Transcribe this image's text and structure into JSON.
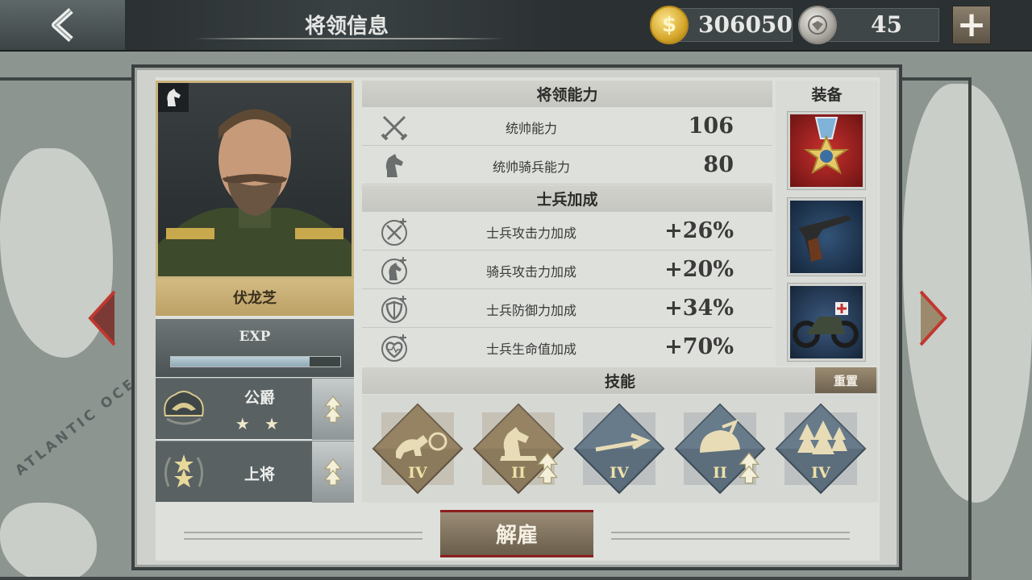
{
  "header": {
    "title": "将领信息",
    "gold": "306050",
    "medals": "45",
    "gold_icon": "$"
  },
  "map": {
    "ocean_label": "ATLANTIC OCE"
  },
  "general": {
    "name": "伏龙芝",
    "exp_label": "EXP",
    "exp_progress": 0.82,
    "nobility": "公爵",
    "nobility_stars": "★ ★",
    "military_rank": "上将"
  },
  "command": {
    "header": "将领能力",
    "stats": [
      {
        "icon": "crossed-swords-icon",
        "label": "统帅能力",
        "value": "106"
      },
      {
        "icon": "knight-horse-icon",
        "label": "统帅骑兵能力",
        "value": "80"
      }
    ]
  },
  "soldier_bonus": {
    "header": "士兵加成",
    "stats": [
      {
        "icon": "attack-plus-icon",
        "label": "士兵攻击力加成",
        "value": "+26%"
      },
      {
        "icon": "cavalry-plus-icon",
        "label": "骑兵攻击力加成",
        "value": "+20%"
      },
      {
        "icon": "shield-plus-icon",
        "label": "士兵防御力加成",
        "value": "+34%"
      },
      {
        "icon": "heart-plus-icon",
        "label": "士兵生命值加成",
        "value": "+70%"
      }
    ]
  },
  "equipment": {
    "header": "装备",
    "items": [
      "medal-icon",
      "pistol-icon",
      "motorcycle-icon"
    ]
  },
  "skills": {
    "header": "技能",
    "reset_label": "重置",
    "items": [
      {
        "icon": "cavalry-charge-skill-icon",
        "level": "IV",
        "color": "#8c7a5c",
        "upgradable": false
      },
      {
        "icon": "knight-skill-icon",
        "level": "II",
        "color": "#8c7a5c",
        "upgradable": true
      },
      {
        "icon": "spear-skill-icon",
        "level": "IV",
        "color": "#5c6e7c",
        "upgradable": false
      },
      {
        "icon": "helmet-skill-icon",
        "level": "II",
        "color": "#5c6e7c",
        "upgradable": true
      },
      {
        "icon": "forest-skill-icon",
        "level": "IV",
        "color": "#5c6e7c",
        "upgradable": false
      }
    ]
  },
  "footer": {
    "dismiss_label": "解雇"
  },
  "colors": {
    "accent_gold": "#d2bb82",
    "dismiss_border": "#8b1e1e"
  }
}
